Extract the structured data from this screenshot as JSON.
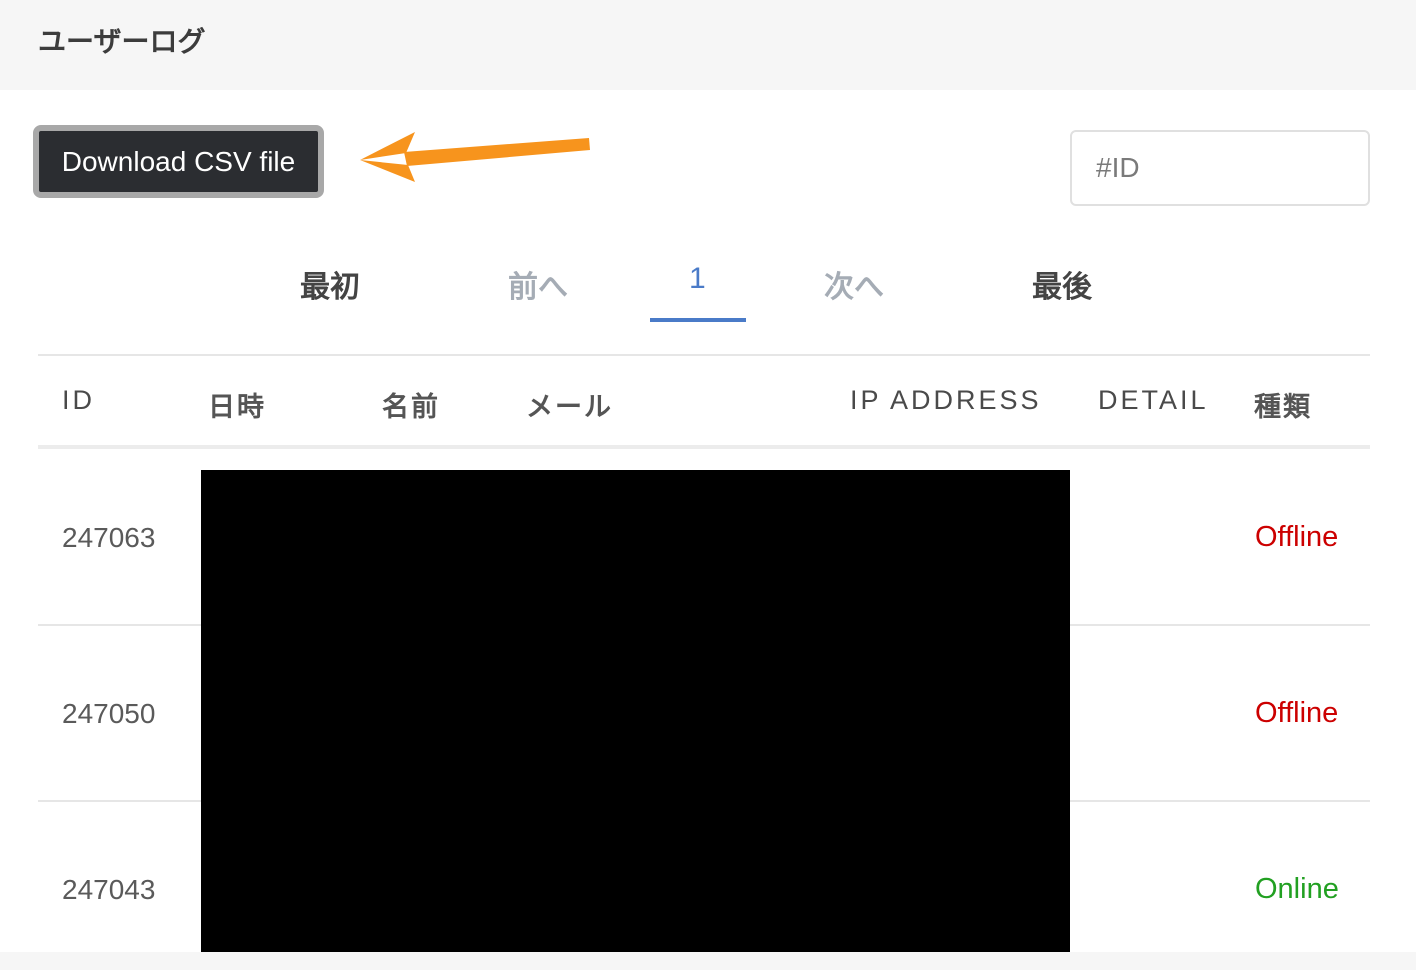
{
  "header": {
    "title": "ユーザーログ"
  },
  "toolbar": {
    "download_label": "Download CSV file",
    "arrow_color": "#f7941d"
  },
  "search": {
    "placeholder": "#ID"
  },
  "pagination": {
    "first": "最初",
    "prev": "前へ",
    "current": "1",
    "next": "次へ",
    "last": "最後"
  },
  "table": {
    "columns": [
      "ID",
      "日時",
      "名前",
      "メール",
      "IP ADDRESS",
      "DETAIL",
      "種類"
    ],
    "rows": [
      {
        "id": "247063",
        "type": "Offline",
        "type_color": "#cc0000"
      },
      {
        "id": "247050",
        "type": "Offline",
        "type_color": "#cc0000"
      },
      {
        "id": "247043",
        "type": "Online",
        "type_color": "#22a022"
      }
    ]
  },
  "colors": {
    "pager_active": "#4a7bc8",
    "pager_disabled": "#a5acb5",
    "offline": "#cc0000",
    "online": "#22a022"
  }
}
